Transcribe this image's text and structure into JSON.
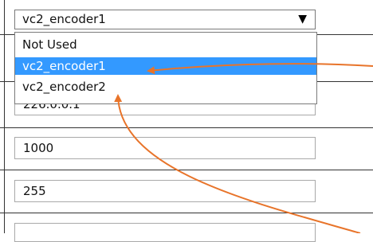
{
  "select": {
    "value": "vc2_encoder1",
    "arrow": "▼",
    "options": [
      "Not Used",
      "vc2_encoder1",
      "vc2_encoder2"
    ],
    "selected_index": 1
  },
  "fields": {
    "address": "226.0.0.1",
    "port": "1000",
    "ttl": "255"
  },
  "annotation_color": "#e8742a"
}
